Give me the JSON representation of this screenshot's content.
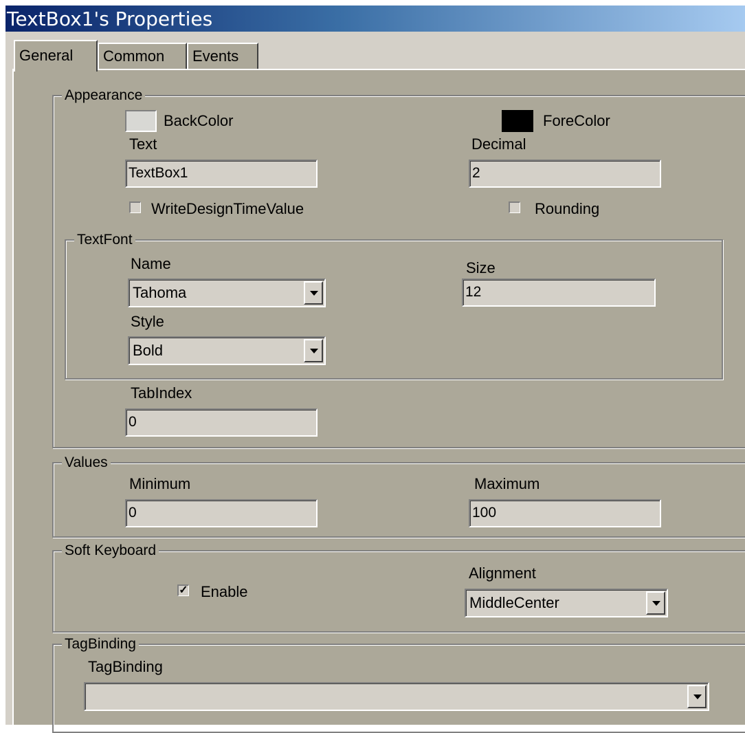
{
  "title": "TextBox1's Properties",
  "tabs": [
    {
      "label": "General",
      "active": true
    },
    {
      "label": "Common",
      "active": false
    },
    {
      "label": "Events",
      "active": false
    }
  ],
  "appearance": {
    "legend": "Appearance",
    "backcolor_label": "BackColor",
    "backcolor_value": "#d8d8d4",
    "forecolor_label": "ForeColor",
    "forecolor_value": "#000000",
    "text_label": "Text",
    "text_value": "TextBox1",
    "decimal_label": "Decimal",
    "decimal_value": "2",
    "write_design_label": "WriteDesignTimeValue",
    "write_design_checked": false,
    "rounding_label": "Rounding",
    "rounding_checked": false,
    "tabindex_label": "TabIndex",
    "tabindex_value": "0"
  },
  "textfont": {
    "legend": "TextFont",
    "name_label": "Name",
    "name_value": "Tahoma",
    "size_label": "Size",
    "size_value": "12",
    "style_label": "Style",
    "style_value": "Bold"
  },
  "values": {
    "legend": "Values",
    "min_label": "Minimum",
    "min_value": "0",
    "max_label": "Maximum",
    "max_value": "100"
  },
  "softkeyboard": {
    "legend": "Soft Keyboard",
    "enable_label": "Enable",
    "enable_checked": true,
    "check_mark": "✓",
    "alignment_label": "Alignment",
    "alignment_value": "MiddleCenter"
  },
  "tagbinding": {
    "legend": "TagBinding",
    "label": "TagBinding",
    "value": ""
  }
}
